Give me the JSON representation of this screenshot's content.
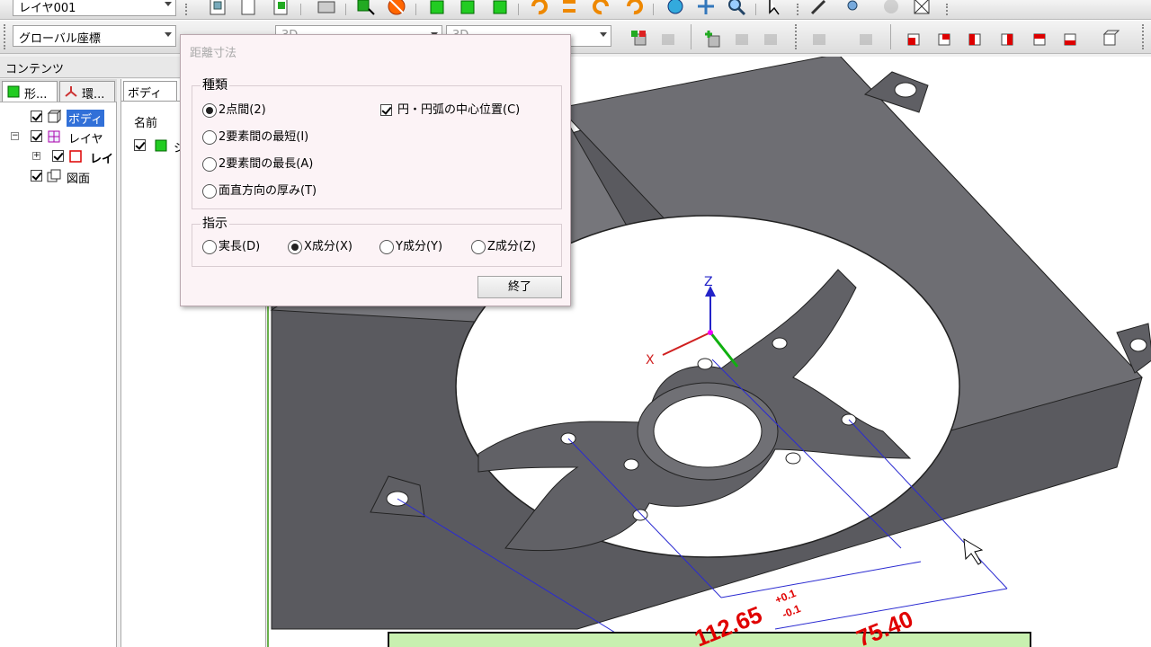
{
  "toolbar": {
    "layer_combo": "レイヤ001",
    "coord_combo": "グローバル座標",
    "combo_3d_a": "3D",
    "combo_3d_b": "3D"
  },
  "panel_header": "コンテンツ",
  "tabs": [
    {
      "label": "形..."
    },
    {
      "label": "環..."
    }
  ],
  "tree": {
    "body": "ボディ",
    "layer": "レイヤ",
    "layer_child": "レイ",
    "drawing": "図面"
  },
  "mid_panel": {
    "tab": "ボディ",
    "column": "名前",
    "row": "シ"
  },
  "dialog": {
    "title": "距離寸法",
    "group_type": "種類",
    "type_options": [
      {
        "label": "2点間(2)",
        "selected": true
      },
      {
        "label": "2要素間の最短(I)",
        "selected": false
      },
      {
        "label": "2要素間の最長(A)",
        "selected": false
      },
      {
        "label": "面直方向の厚み(T)",
        "selected": false
      }
    ],
    "center_check": {
      "label": "円・円弧の中心位置(C)",
      "checked": true
    },
    "group_indicate": "指示",
    "indicate_options": [
      {
        "label": "実長(D)",
        "selected": false
      },
      {
        "label": "X成分(X)",
        "selected": true
      },
      {
        "label": "Y成分(Y)",
        "selected": false
      },
      {
        "label": "Z成分(Z)",
        "selected": false
      }
    ],
    "finish_button": "終了"
  },
  "viewport": {
    "axis_z": "Z",
    "axis_x": "X",
    "dim1_value": "112.65",
    "dim1_tol_plus": "+0.1",
    "dim1_tol_minus": "-0.1",
    "dim2_value": "75.40"
  },
  "colors": {
    "accent_green": "#00b000",
    "dim_red": "#e00000",
    "model_gray": "#5a5a5f"
  }
}
